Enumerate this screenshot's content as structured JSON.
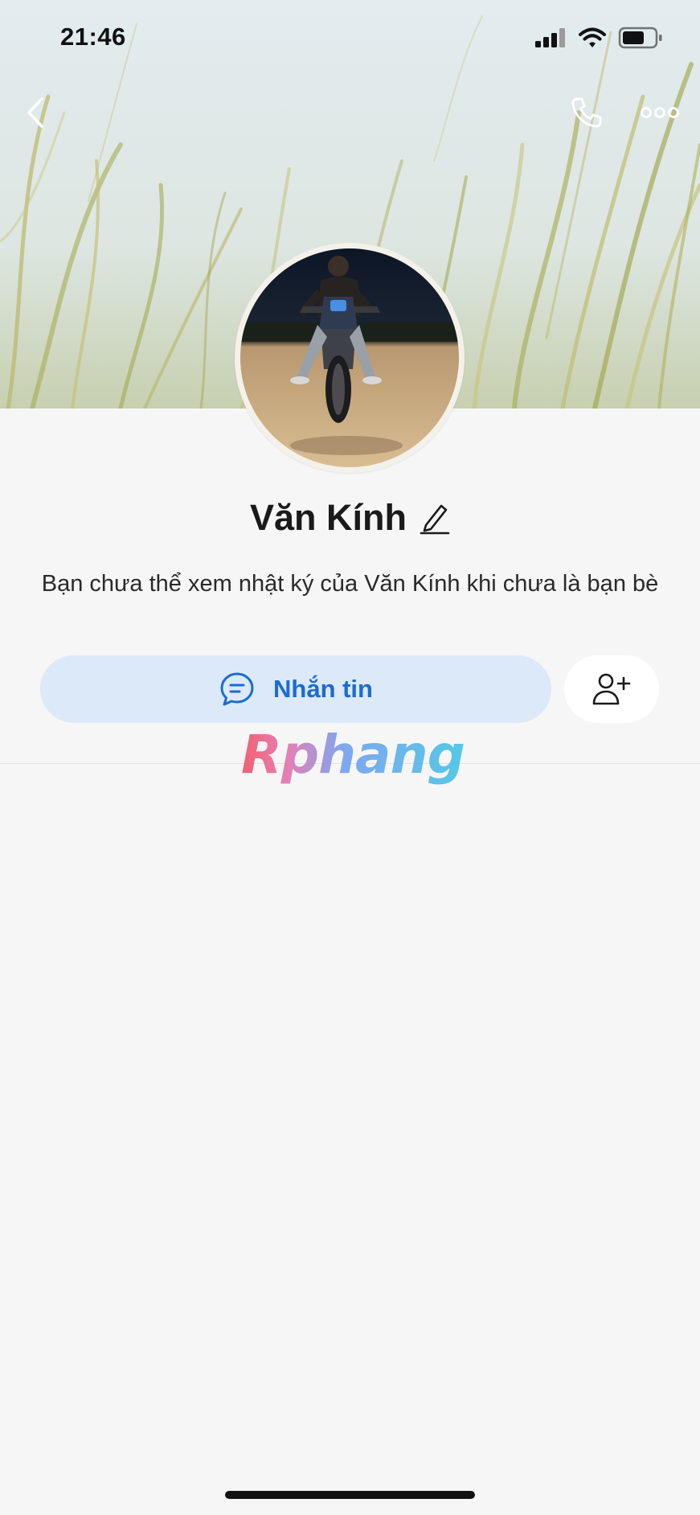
{
  "status_bar": {
    "time": "21:46",
    "signal_icon": "signal-icon",
    "wifi_icon": "wifi-icon",
    "battery_icon": "battery-icon"
  },
  "nav": {
    "back_icon": "chevron-left-icon",
    "call_icon": "phone-icon",
    "more_icon": "more-horizontal-icon"
  },
  "profile": {
    "name": "Văn Kính",
    "edit_icon": "pencil-icon",
    "description": "Bạn chưa thể xem nhật ký của Văn Kính khi chưa là bạn bè"
  },
  "actions": {
    "message_label": "Nhắn tin",
    "message_icon": "chat-bubble-icon",
    "add_friend_icon": "add-friend-icon"
  },
  "watermark": "Rphang",
  "colors": {
    "accent": "#1b6bd2",
    "message_button_bg": "#dce9f9",
    "background": "#f6f6f6"
  }
}
